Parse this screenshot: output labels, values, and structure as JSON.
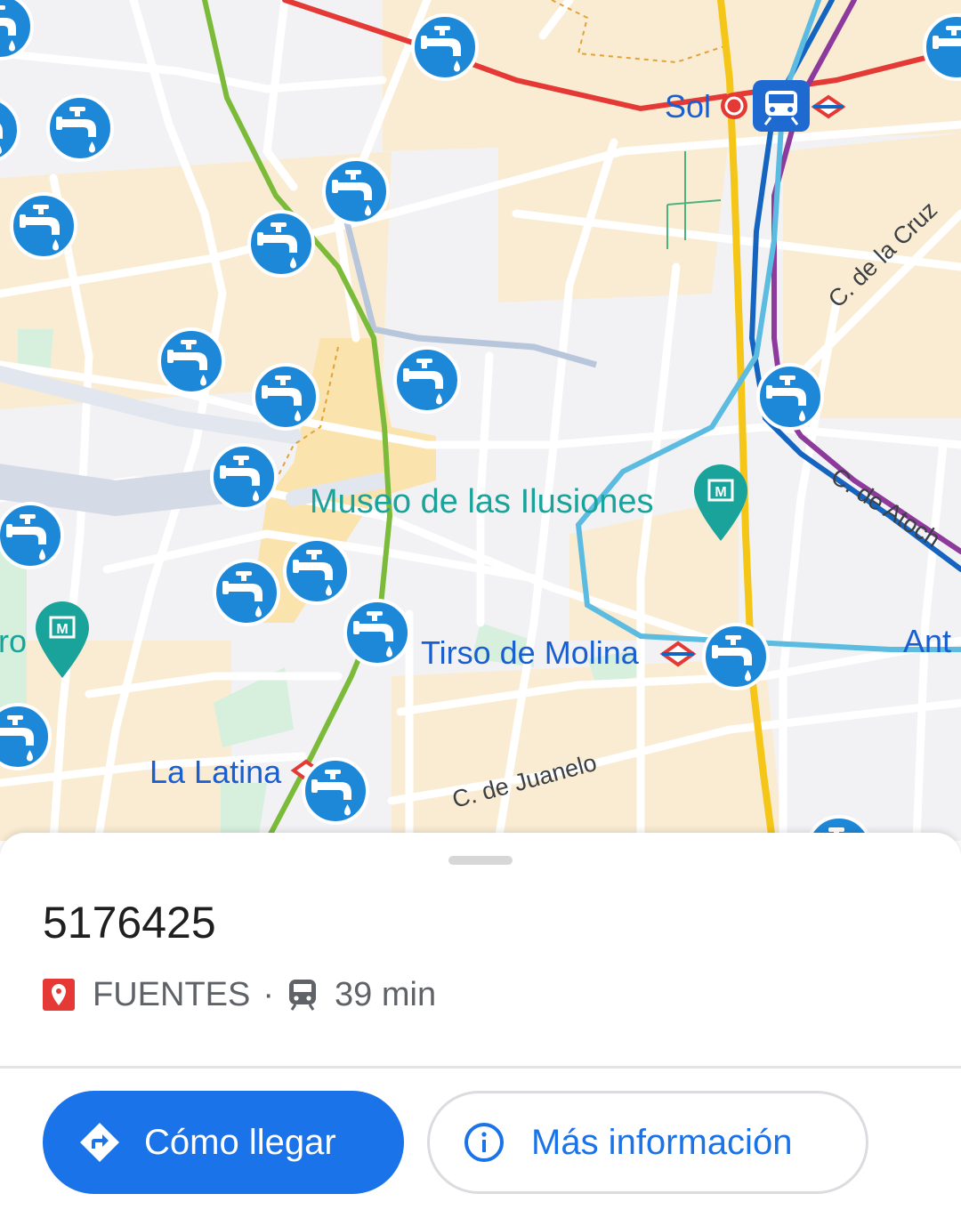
{
  "map": {
    "labels": {
      "sol": "Sol",
      "museo": "Museo de las Ilusiones",
      "tirso": "Tirso de Molina",
      "la_latina": "La Latina",
      "c_cruz": "C. de la Cruz",
      "c_atocha": "C. de Atoch",
      "c_juanelo": "C. de Juanelo",
      "anton": "Ant",
      "left_edge": "ro"
    },
    "colors": {
      "metro_line_red": "#e53935",
      "metro_line_green": "#7cbb3a",
      "metro_line_yellow": "#f5c518",
      "metro_line_lightblue": "#5bbbe0",
      "metro_line_darkblue": "#1565c0",
      "metro_line_purple": "#8e3a9c",
      "marker_blue": "#1e88d8",
      "poi_teal": "#1aa39a"
    },
    "marker_icon": "water-tap-icon",
    "museum_icon": "museum-icon",
    "transit_icon": "train-icon"
  },
  "sheet": {
    "title": "5176425",
    "category": "FUENTES",
    "separator": "·",
    "transit_time": "39 min",
    "category_icon": "location-pin-icon",
    "transit_icon": "train-icon"
  },
  "actions": {
    "directions_label": "Cómo llegar",
    "more_info_label": "Más información",
    "directions_icon": "directions-icon",
    "info_icon": "info-icon"
  }
}
